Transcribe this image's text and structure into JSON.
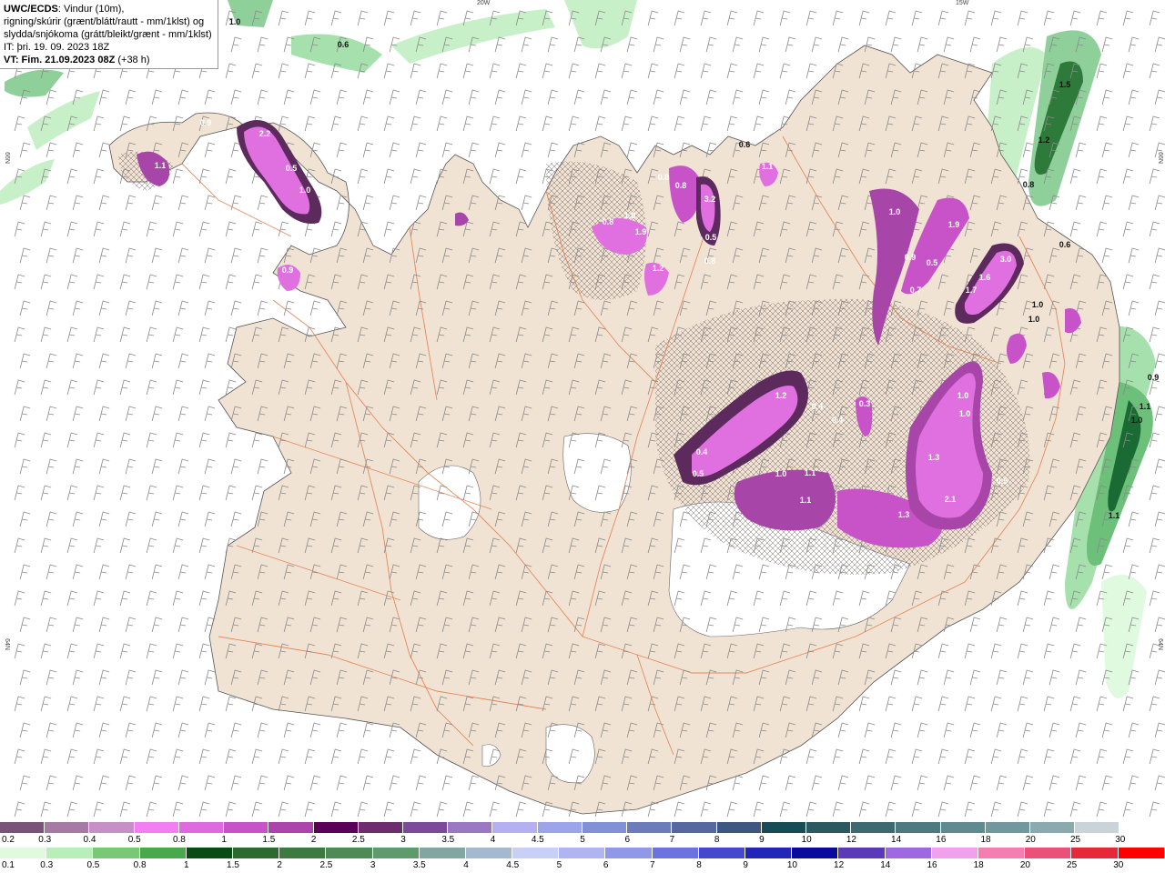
{
  "header": {
    "model": "UWC/ECDS",
    "line1_rest": ": Vindur (10m),",
    "line2": "rigning/skúrir (grænt/blátt/rautt - mm/1klst) og",
    "line3": "slydda/snjókoma (grátt/bleikt/grænt - mm/1klst)",
    "line4": "IT: þri. 19. 09. 2023 18Z",
    "line5_bold": "VT: Fim. 21.09.2023 08Z",
    "line5_rest": " (+38 h)"
  },
  "axes": {
    "lon_top_1": "20W",
    "lon_top_2": "15W",
    "lat_left_1": "66N",
    "lat_left_2": "64N",
    "lat_right_1": "66N",
    "lat_right_2": "64N"
  },
  "colors": {
    "sea": "#ffffff",
    "land": "#f1e3d3",
    "glacier": "#ffffff",
    "roads": "#e07a4a",
    "snow_dark": "#5c2a5c",
    "snow_mid": "#a845a8",
    "snow_light": "#e070e0",
    "rain_light": "#c8f0c8",
    "rain_mid": "#6cc07a",
    "rain_dark": "#1a6a34"
  },
  "snow_scale": {
    "labels": [
      "0.2",
      "0.3",
      "0.4",
      "0.5",
      "0.8",
      "1",
      "1.5",
      "2",
      "2.5",
      "3",
      "3.5",
      "4",
      "4.5",
      "5",
      "6",
      "7",
      "8",
      "9",
      "10",
      "12",
      "14",
      "16",
      "18",
      "20",
      "25",
      "30"
    ],
    "colors": [
      "#7a5478",
      "#a57aa3",
      "#c68fc6",
      "#f27ef2",
      "#df6adf",
      "#c853c8",
      "#ad43ad",
      "#5a0059",
      "#6c2c6e",
      "#7c4a9a",
      "#9a78c2",
      "#b4b0f2",
      "#9ca4ea",
      "#8290d6",
      "#6c7cba",
      "#56689e",
      "#3e5682",
      "#184c54",
      "#2a5a60",
      "#3c6a70",
      "#4c7a80",
      "#5e8a90",
      "#70989e",
      "#8aaab0",
      "#c8d4d8",
      "#ffffff"
    ]
  },
  "rain_scale": {
    "labels": [
      "0.1",
      "0.3",
      "0.5",
      "0.8",
      "1",
      "1.5",
      "2",
      "2.5",
      "3",
      "3.5",
      "4",
      "4.5",
      "5",
      "6",
      "7",
      "8",
      "9",
      "10",
      "12",
      "14",
      "16",
      "18",
      "20",
      "25",
      "30"
    ],
    "colors": [
      "#e0fae0",
      "#b8eeb8",
      "#78c878",
      "#48a84c",
      "#0a4a14",
      "#2e6a2e",
      "#3e7a40",
      "#4e8a56",
      "#5e9a6c",
      "#80a8a0",
      "#a4b8d0",
      "#c8d0f8",
      "#b0b4f0",
      "#9098e8",
      "#6c72e0",
      "#4448cc",
      "#2226b8",
      "#0a0a9c",
      "#5a3ab8",
      "#a068e0",
      "#f0a0ec",
      "#f47eb0",
      "#ea5078",
      "#e62838",
      "#ff0000"
    ]
  },
  "map_values": [
    {
      "t": "1.0",
      "c": "dark"
    },
    {
      "t": "0.6",
      "c": "dark"
    },
    {
      "t": "2.2",
      "c": "light"
    },
    {
      "t": "0.9",
      "c": "light"
    },
    {
      "t": "1.0",
      "c": "light"
    },
    {
      "t": "0.5",
      "c": "light"
    },
    {
      "t": "1.1",
      "c": "light"
    },
    {
      "t": "0.9",
      "c": "light"
    },
    {
      "t": "0.6",
      "c": "dark"
    },
    {
      "t": "1.0",
      "c": "light"
    },
    {
      "t": "0.8",
      "c": "light"
    },
    {
      "t": "1.9",
      "c": "light"
    },
    {
      "t": "1.2",
      "c": "light"
    },
    {
      "t": "0.8",
      "c": "light"
    },
    {
      "t": "0.8",
      "c": "light"
    },
    {
      "t": "3.2",
      "c": "light"
    },
    {
      "t": "0.5",
      "c": "light"
    },
    {
      "t": "1.1",
      "c": "light"
    },
    {
      "t": "0.8",
      "c": "light"
    },
    {
      "t": "1.0",
      "c": "light"
    },
    {
      "t": "1.9",
      "c": "light"
    },
    {
      "t": "0.9",
      "c": "light"
    },
    {
      "t": "0.5",
      "c": "light"
    },
    {
      "t": "0.7",
      "c": "light"
    },
    {
      "t": "3.0",
      "c": "light"
    },
    {
      "t": "1.7",
      "c": "light"
    },
    {
      "t": "1.6",
      "c": "light"
    },
    {
      "t": "1.5",
      "c": "dark"
    },
    {
      "t": "1.2",
      "c": "dark"
    },
    {
      "t": "0.8",
      "c": "dark"
    },
    {
      "t": "0.6",
      "c": "dark"
    },
    {
      "t": "1.0",
      "c": "dark"
    },
    {
      "t": "1.0",
      "c": "dark"
    },
    {
      "t": "0.9",
      "c": "dark"
    },
    {
      "t": "1.1",
      "c": "dark"
    },
    {
      "t": "1.0",
      "c": "dark"
    },
    {
      "t": "1.1",
      "c": "dark"
    },
    {
      "t": "1.2",
      "c": "light"
    },
    {
      "t": "0.4",
      "c": "light"
    },
    {
      "t": "0.4",
      "c": "light"
    },
    {
      "t": "0.3",
      "c": "light"
    },
    {
      "t": "1.0",
      "c": "light"
    },
    {
      "t": "1.0",
      "c": "light"
    },
    {
      "t": "0.4",
      "c": "light"
    },
    {
      "t": "0.5",
      "c": "light"
    },
    {
      "t": "1.0",
      "c": "light"
    },
    {
      "t": "1.1",
      "c": "light"
    },
    {
      "t": "1.1",
      "c": "light"
    },
    {
      "t": "1.3",
      "c": "light"
    },
    {
      "t": "1.3",
      "c": "light"
    },
    {
      "t": "2.1",
      "c": "light"
    },
    {
      "t": "0.5",
      "c": "light"
    }
  ]
}
